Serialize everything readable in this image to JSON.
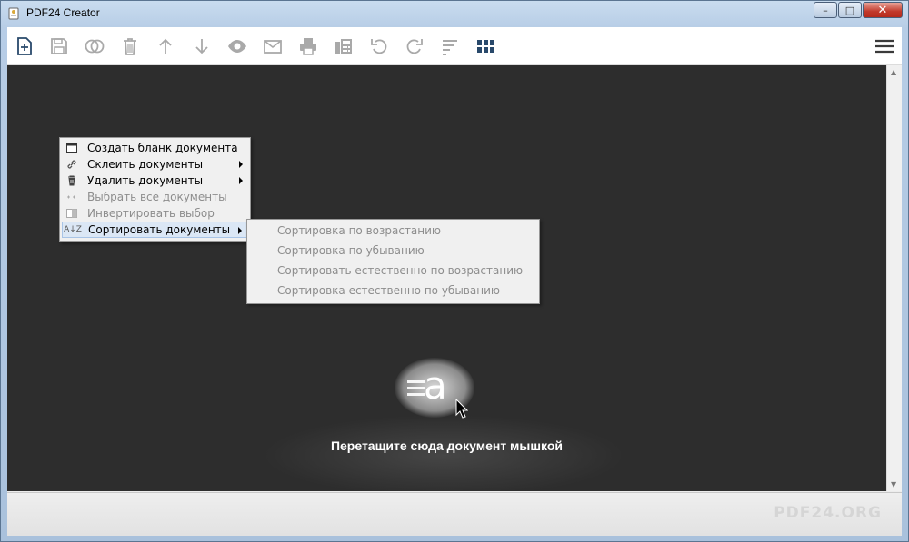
{
  "window": {
    "title": "PDF24 Creator",
    "controls": {
      "minimize": "–",
      "maximize": "□",
      "close": "✕"
    }
  },
  "toolbar": {
    "buttons": [
      {
        "name": "new-document",
        "icon": "file-plus-icon"
      },
      {
        "name": "save",
        "icon": "floppy-icon"
      },
      {
        "name": "merge",
        "icon": "circles-icon"
      },
      {
        "name": "delete",
        "icon": "trash-icon"
      },
      {
        "name": "move-up",
        "icon": "arrow-up-icon"
      },
      {
        "name": "move-down",
        "icon": "arrow-down-icon"
      },
      {
        "name": "preview",
        "icon": "eye-icon"
      },
      {
        "name": "email",
        "icon": "mail-icon"
      },
      {
        "name": "print",
        "icon": "printer-icon"
      },
      {
        "name": "fax",
        "icon": "fax-icon"
      },
      {
        "name": "rotate-left",
        "icon": "rotate-left-icon"
      },
      {
        "name": "rotate-right",
        "icon": "rotate-right-icon"
      },
      {
        "name": "sort",
        "icon": "sort-lines-icon"
      },
      {
        "name": "grid-view",
        "icon": "grid-icon"
      }
    ],
    "menu_icon": "hamburger-icon",
    "colors": {
      "icon": "#a9a9a9",
      "icon_dark": "#3a3a3a",
      "accent": "#29496b"
    }
  },
  "dropzone": {
    "hint": "Перетащите сюда документ мышкой",
    "background": "#2d2d2d"
  },
  "context_menu": {
    "items": [
      {
        "label": "Создать бланк документа",
        "icon": "blank-page-icon",
        "enabled": true,
        "submenu": false
      },
      {
        "label": "Склеить документы",
        "icon": "link-icon",
        "enabled": true,
        "submenu": true
      },
      {
        "label": "Удалить документы",
        "icon": "trash-icon",
        "enabled": true,
        "submenu": true
      },
      {
        "label": "Выбрать все документы",
        "icon": "select-all-icon",
        "enabled": false,
        "submenu": false
      },
      {
        "label": "Инвертировать выбор",
        "icon": "invert-icon",
        "enabled": false,
        "submenu": false
      },
      {
        "label": "Сортировать документы",
        "icon": "az-sort-icon",
        "enabled": true,
        "submenu": true,
        "highlighted": true
      }
    ]
  },
  "sort_submenu": {
    "items": [
      {
        "label": "Сортировка по возрастанию"
      },
      {
        "label": "Сортировка по убыванию"
      },
      {
        "label": "Сортировать естественно по возрастанию"
      },
      {
        "label": "Сортировка естественно по убыванию"
      }
    ]
  },
  "footer": {
    "brand": "PDF24.ORG"
  }
}
